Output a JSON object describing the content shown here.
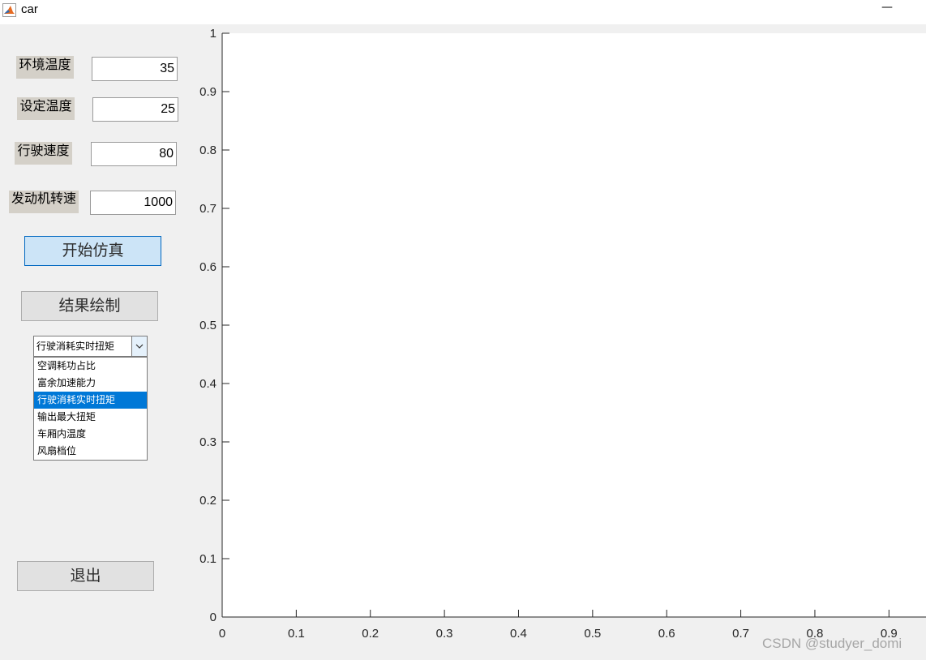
{
  "window": {
    "title": "car",
    "minimize_symbol": "—",
    "icon": "matlab-icon"
  },
  "params": [
    {
      "label": "环境温度",
      "value": "35"
    },
    {
      "label": "设定温度",
      "value": "25"
    },
    {
      "label": "行驶速度",
      "value": "80"
    },
    {
      "label": "发动机转速",
      "value": "1000"
    }
  ],
  "buttons": {
    "simulate": "开始仿真",
    "plot": "结果绘制",
    "exit": "退出"
  },
  "dropdown": {
    "selected": "行驶消耗实时扭矩",
    "options": [
      "空调耗功占比",
      "富余加速能力",
      "行驶消耗实时扭矩",
      "输出最大扭矩",
      "车厢内温度",
      "风扇档位"
    ],
    "selected_index": 2
  },
  "colors": {
    "accent": "#0078d7",
    "primary_button": "#cce4f7",
    "label_bg": "#d4d0c8"
  },
  "chart_data": {
    "type": "line",
    "title": "",
    "xlabel": "",
    "ylabel": "",
    "xlim": [
      0,
      0.95
    ],
    "ylim": [
      0,
      1
    ],
    "xticks": [
      "0",
      "0.1",
      "0.2",
      "0.3",
      "0.4",
      "0.5",
      "0.6",
      "0.7",
      "0.8",
      "0.9"
    ],
    "yticks": [
      "0",
      "0.1",
      "0.2",
      "0.3",
      "0.4",
      "0.5",
      "0.6",
      "0.7",
      "0.8",
      "0.9",
      "1"
    ],
    "series": [],
    "grid": false
  },
  "watermark": "CSDN @studyer_domi"
}
